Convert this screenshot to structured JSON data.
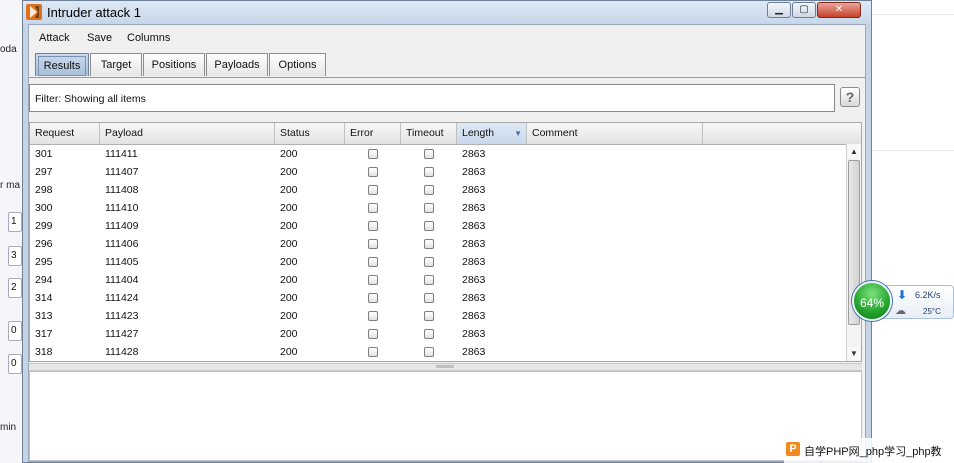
{
  "window": {
    "title": "Intruder attack 1"
  },
  "menu": [
    "Attack",
    "Save",
    "Columns"
  ],
  "tabs": [
    "Results",
    "Target",
    "Positions",
    "Payloads",
    "Options"
  ],
  "active_tab": "Results",
  "filter": {
    "text": "Filter:  Showing all items"
  },
  "table": {
    "columns": [
      "Request",
      "Payload",
      "Status",
      "Error",
      "Timeout",
      "Length",
      "Comment"
    ],
    "sorted_column": "Length",
    "rows": [
      {
        "request": "301",
        "payload": "111411",
        "status": "200",
        "error": false,
        "timeout": false,
        "length": "2863",
        "comment": ""
      },
      {
        "request": "297",
        "payload": "111407",
        "status": "200",
        "error": false,
        "timeout": false,
        "length": "2863",
        "comment": ""
      },
      {
        "request": "298",
        "payload": "111408",
        "status": "200",
        "error": false,
        "timeout": false,
        "length": "2863",
        "comment": ""
      },
      {
        "request": "300",
        "payload": "111410",
        "status": "200",
        "error": false,
        "timeout": false,
        "length": "2863",
        "comment": ""
      },
      {
        "request": "299",
        "payload": "111409",
        "status": "200",
        "error": false,
        "timeout": false,
        "length": "2863",
        "comment": ""
      },
      {
        "request": "296",
        "payload": "111406",
        "status": "200",
        "error": false,
        "timeout": false,
        "length": "2863",
        "comment": ""
      },
      {
        "request": "295",
        "payload": "111405",
        "status": "200",
        "error": false,
        "timeout": false,
        "length": "2863",
        "comment": ""
      },
      {
        "request": "294",
        "payload": "111404",
        "status": "200",
        "error": false,
        "timeout": false,
        "length": "2863",
        "comment": ""
      },
      {
        "request": "314",
        "payload": "111424",
        "status": "200",
        "error": false,
        "timeout": false,
        "length": "2863",
        "comment": ""
      },
      {
        "request": "313",
        "payload": "111423",
        "status": "200",
        "error": false,
        "timeout": false,
        "length": "2863",
        "comment": ""
      },
      {
        "request": "317",
        "payload": "111427",
        "status": "200",
        "error": false,
        "timeout": false,
        "length": "2863",
        "comment": ""
      },
      {
        "request": "318",
        "payload": "111428",
        "status": "200",
        "error": false,
        "timeout": false,
        "length": "2863",
        "comment": ""
      }
    ]
  },
  "background": {
    "fragments": [
      "oda",
      "r ma",
      "min"
    ],
    "boxes": [
      "1",
      "3",
      "2",
      "0",
      "0"
    ]
  },
  "widget": {
    "percent": "64%",
    "speed": "6.2K/s",
    "temp": "25°C"
  },
  "watermark": {
    "logo": "P",
    "text": "自学PHP网_php学习_php教"
  },
  "colors": {
    "accent": "#c4d3e6",
    "gauge": "#22a32c",
    "close": "#c8412c"
  },
  "icons": [
    "app-icon",
    "help-icon",
    "sort-desc-icon",
    "download-icon",
    "cloud-icon"
  ]
}
